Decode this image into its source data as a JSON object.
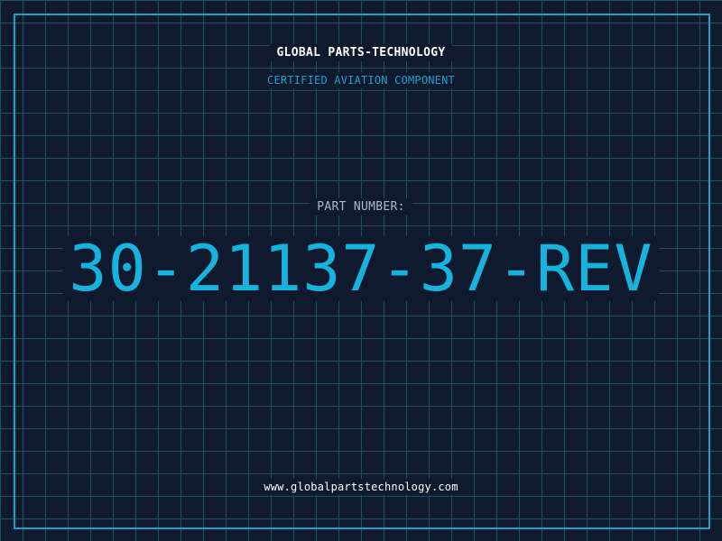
{
  "header": {
    "company": "GLOBAL PARTS-TECHNOLOGY",
    "subtitle": "CERTIFIED AVIATION COMPONENT"
  },
  "part": {
    "label": "PART NUMBER:",
    "number": "30-21137-37-REV"
  },
  "footer": {
    "url": "www.globalpartstechnology.com"
  },
  "colors": {
    "background": "#0f1a2e",
    "grid": "#1f4e66",
    "accent": "#1aa3c7",
    "part_number": "#16b3de"
  }
}
